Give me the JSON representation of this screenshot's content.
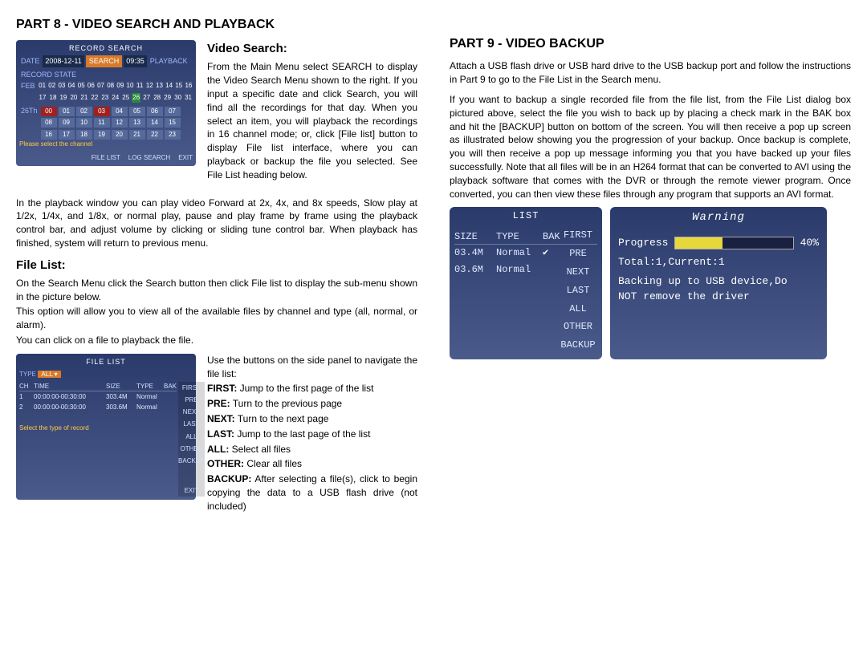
{
  "left": {
    "h2": "PART 8 - VIDEO SEARCH AND PLAYBACK",
    "vs_heading": "Video Search:",
    "vs_text": "From the Main Menu select SEARCH to display the Video Search Menu shown to the right. If you input a specific date and click Search, you will find all the recordings for that day. When you select an item, you will playback the recordings in 16 channel mode; or, click [File list] button to display File list interface, where you can playback or backup the file you selected. See File List heading below.",
    "playback_para": "In the playback window you can play video Forward at 2x, 4x, and 8x speeds, Slow play at 1/2x, 1/4x, and 1/8x, or normal play, pause and play frame by frame using the playback control bar, and adjust volume by clicking or sliding tune control bar. When playback has finished, system will return to previous menu.",
    "fl_heading": "File List:",
    "fl_p1": "On the Search Menu click the Search button then click File list to display the sub-menu shown in the picture below.",
    "fl_p2": "This option will allow you to view all of the available files by channel and type (all, normal, or alarm).",
    "fl_p3": "You can click on a file to playback the file.",
    "fl_intro": "Use the buttons on the side panel to navigate the file list:",
    "first_lbl": "FIRST:",
    "first_txt": " Jump to the first page of the list",
    "pre_lbl": "PRE:",
    "pre_txt": " Turn to the previous page",
    "next_lbl": "NEXT:",
    "next_txt": " Turn to the next page",
    "last_lbl": "LAST:",
    "last_txt": " Jump to the last page of the list",
    "all_lbl": "ALL:",
    "all_txt": " Select all files",
    "other_lbl": "OTHER:",
    "other_txt": " Clear all files",
    "backup_lbl": "BACKUP:",
    "backup_txt": " After selecting a file(s), click to begin copying the data to a USB flash drive (not included)"
  },
  "right": {
    "h2": "PART 9 - VIDEO BACKUP",
    "p1": "Attach a USB flash drive or USB hard drive to the USB backup port and follow the instructions in Part 9 to go to the File List in the Search menu.",
    "p2": "If you want to backup a single recorded file from the file list, from the File List dialog box pictured above, select the file you wish to back up by placing a check mark in the BAK box and hit the [BACKUP] button on bottom of the screen.  You will then receive a pop up screen as illustrated below showing you the progression of your backup.  Once backup is complete, you will then receive a pop up message informing you that you have backed up your files successfully. Note that all files will be in an H264 format that can be converted to AVI using the playback software that comes with the DVR or through the remote viewer program.  Once converted, you can then view these files through any program that supports an AVI format."
  },
  "shot_search": {
    "title": "RECORD SEARCH",
    "date_lbl": "DATE",
    "date_val": "2008-12-11",
    "search_btn": "SEARCH",
    "time_val": "09:35",
    "play_lbl": "PLAYBACK",
    "rec_lbl": "RECORD STATE",
    "month": "FEB",
    "days1": [
      "01",
      "02",
      "03",
      "04",
      "05",
      "06",
      "07",
      "08",
      "09",
      "10",
      "11",
      "12",
      "13",
      "14",
      "15",
      "16"
    ],
    "days2": [
      "17",
      "18",
      "19",
      "20",
      "21",
      "22",
      "23",
      "24",
      "25",
      "26",
      "27",
      "28",
      "29",
      "30",
      "31"
    ],
    "daylbl": "26Th",
    "hours1": [
      "00",
      "01",
      "02",
      "03",
      "04",
      "05",
      "06",
      "07"
    ],
    "hours2": [
      "08",
      "09",
      "10",
      "11",
      "12",
      "13",
      "14",
      "15"
    ],
    "hours3": [
      "16",
      "17",
      "18",
      "19",
      "20",
      "21",
      "22",
      "23"
    ],
    "hint": "Please select the channel",
    "foot": [
      "FILE LIST",
      "LOG SEARCH",
      "EXIT"
    ]
  },
  "shot_filelist": {
    "title": "FILE LIST",
    "type_lbl": "TYPE",
    "type_val": "ALL ▾",
    "hdr": [
      "CH",
      "TIME",
      "SIZE",
      "TYPE",
      "BAK"
    ],
    "rows": [
      [
        "1",
        "00:00:00-00:30:00",
        "303.4M",
        "Normal",
        ""
      ],
      [
        "2",
        "00:00:00-00:30:00",
        "303.6M",
        "Normal",
        ""
      ]
    ],
    "side": [
      "FIRST",
      "PRE",
      "NEXT",
      "LAST",
      "ALL",
      "OTHER",
      "BACKUP"
    ],
    "hint": "Select the type of record",
    "exit": "EXIT"
  },
  "shot_blist": {
    "title": "LIST",
    "hdr": [
      "SIZE",
      "TYPE",
      "BAK"
    ],
    "rows": [
      [
        "03.4M",
        "Normal",
        "✔"
      ],
      [
        "03.6M",
        "Normal",
        ""
      ]
    ],
    "side": [
      "FIRST",
      "PRE",
      "NEXT",
      "LAST",
      "ALL",
      "OTHER",
      "BACKUP"
    ]
  },
  "shot_warn": {
    "title": "Warning",
    "progress_lbl": "Progress",
    "progress_pct": "40%",
    "total": "Total:1,Current:1",
    "line1": "Backing up to USB device,Do",
    "line2": "NOT remove the driver"
  }
}
